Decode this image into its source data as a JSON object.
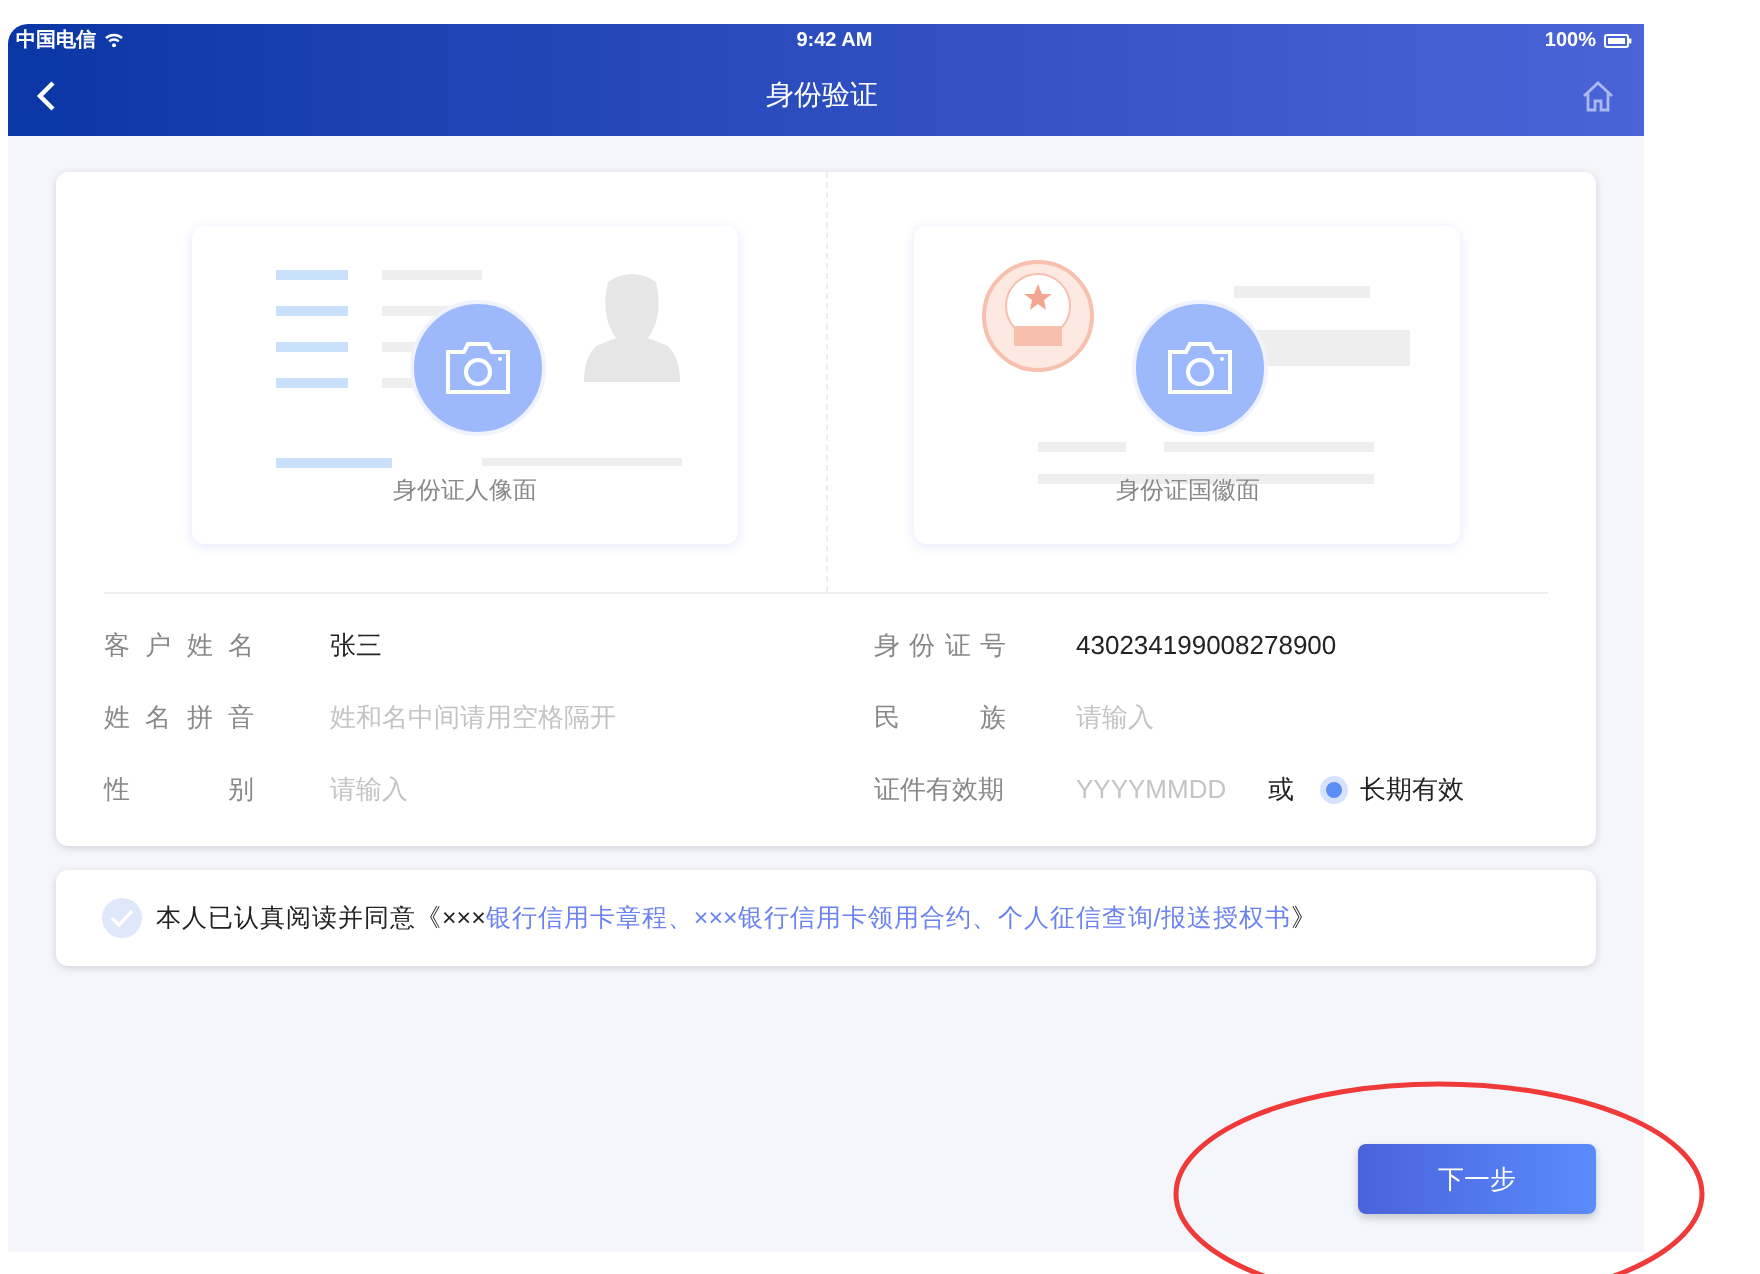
{
  "status_bar": {
    "carrier": "中国电信",
    "time": "9:42 AM",
    "battery": "100%"
  },
  "nav_bar": {
    "title": "身份验证"
  },
  "id_cards": [
    {
      "kind": "portrait",
      "label": "身份证人像面"
    },
    {
      "kind": "emblem",
      "label": "身份证国徽面"
    }
  ],
  "form_fields": [
    {
      "label": "客户姓名",
      "value": "张三"
    },
    {
      "label": "身份证号",
      "value": "430234199008278900"
    },
    {
      "label": "姓名拼音",
      "placeholder": "姓和名中间请用空格隔开"
    },
    {
      "label": "民族",
      "placeholder": "请输入"
    },
    {
      "label": "性别",
      "placeholder": "请输入"
    },
    {
      "label": "证件有效期",
      "placeholder": "YYYYMMDD",
      "or_text": "或",
      "option": {
        "label": "长期有效",
        "selected": true
      }
    }
  ],
  "agreement": {
    "checked": false,
    "prefix": "本人已认真阅读并同意《×××",
    "link": "银行信用卡章程、×××银行信用卡领用合约、个人征信查询/报送授权书",
    "suffix": "》"
  },
  "next_button": {
    "label": "下一步"
  }
}
